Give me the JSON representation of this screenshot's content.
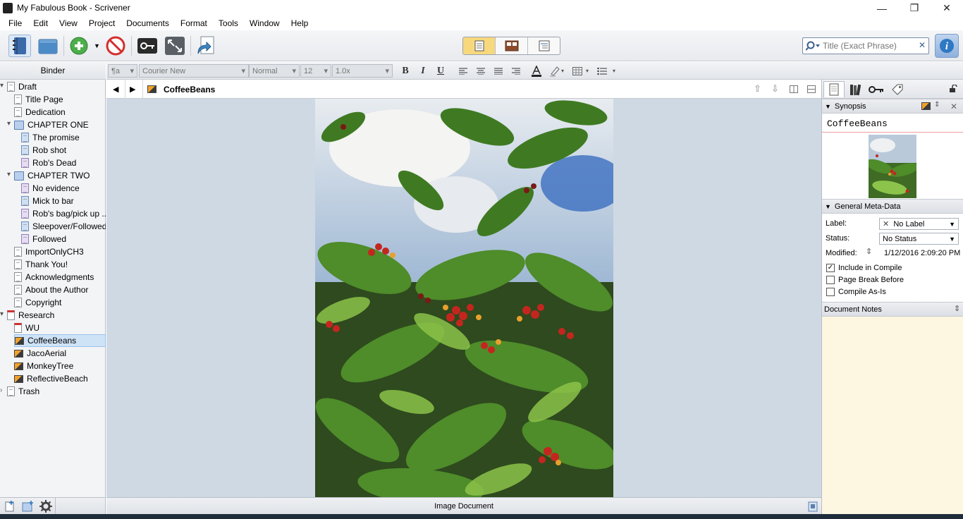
{
  "window": {
    "title": "My Fabulous Book - Scrivener",
    "minimize": "—",
    "maximize": "❐",
    "close": "✕"
  },
  "menu": [
    "File",
    "Edit",
    "View",
    "Project",
    "Documents",
    "Format",
    "Tools",
    "Window",
    "Help"
  ],
  "toolbar": {
    "search_placeholder": "Title (Exact Phrase)",
    "view_modes": [
      "scrivenings-view",
      "corkboard-view",
      "outliner-view"
    ],
    "active_view": 0
  },
  "binder": {
    "header": "Binder",
    "items": [
      {
        "label": "Draft",
        "depth": 0,
        "icon": "draft",
        "toggle": "▾"
      },
      {
        "label": "Title Page",
        "depth": 1,
        "icon": "doc"
      },
      {
        "label": "Dedication",
        "depth": 1,
        "icon": "doc"
      },
      {
        "label": "CHAPTER ONE",
        "depth": 1,
        "icon": "folder",
        "toggle": "▾"
      },
      {
        "label": "The promise",
        "depth": 2,
        "icon": "doc-blue"
      },
      {
        "label": "Rob shot",
        "depth": 2,
        "icon": "doc-blue"
      },
      {
        "label": "Rob's Dead",
        "depth": 2,
        "icon": "doc-purple"
      },
      {
        "label": "CHAPTER TWO",
        "depth": 1,
        "icon": "folder",
        "toggle": "▾"
      },
      {
        "label": "No evidence",
        "depth": 2,
        "icon": "doc-purple"
      },
      {
        "label": "Mick to bar",
        "depth": 2,
        "icon": "doc-blue"
      },
      {
        "label": "Rob's bag/pick up ...",
        "depth": 2,
        "icon": "doc-purple"
      },
      {
        "label": "Sleepover/Followed",
        "depth": 2,
        "icon": "doc-blue"
      },
      {
        "label": "Followed",
        "depth": 2,
        "icon": "doc-purple"
      },
      {
        "label": "ImportOnlyCH3",
        "depth": 1,
        "icon": "doc"
      },
      {
        "label": "Thank You!",
        "depth": 1,
        "icon": "doc"
      },
      {
        "label": "Acknowledgments",
        "depth": 1,
        "icon": "doc"
      },
      {
        "label": "About the Author",
        "depth": 1,
        "icon": "doc"
      },
      {
        "label": "Copyright",
        "depth": 1,
        "icon": "doc"
      },
      {
        "label": "Research",
        "depth": 0,
        "icon": "research",
        "toggle": "▾"
      },
      {
        "label": "WU",
        "depth": 1,
        "icon": "pdf"
      },
      {
        "label": "CoffeeBeans",
        "depth": 1,
        "icon": "image",
        "selected": true
      },
      {
        "label": "JacoAerial",
        "depth": 1,
        "icon": "image"
      },
      {
        "label": "MonkeyTree",
        "depth": 1,
        "icon": "image"
      },
      {
        "label": "ReflectiveBeach",
        "depth": 1,
        "icon": "image"
      },
      {
        "label": "Trash",
        "depth": 0,
        "icon": "trash",
        "toggle": "›"
      }
    ]
  },
  "format": {
    "style": "¶a",
    "font": "Courier New",
    "weight": "Normal",
    "size": "12",
    "line_spacing": "1.0x"
  },
  "editor": {
    "doc_title": "CoffeeBeans",
    "footer": "Image Document"
  },
  "inspector": {
    "synopsis_header": "Synopsis",
    "synopsis_title": "CoffeeBeans",
    "metadata_header": "General Meta-Data",
    "label_caption": "Label:",
    "label_value": "No Label",
    "status_caption": "Status:",
    "status_value": "No Status",
    "modified_caption": "Modified:",
    "modified_value": "1/12/2016 2:09:20 PM",
    "checks": [
      {
        "label": "Include in Compile",
        "checked": true
      },
      {
        "label": "Page Break Before",
        "checked": false
      },
      {
        "label": "Compile As-Is",
        "checked": false
      }
    ],
    "notes_header": "Document Notes",
    "notes_bg": "#fdf7e1"
  }
}
